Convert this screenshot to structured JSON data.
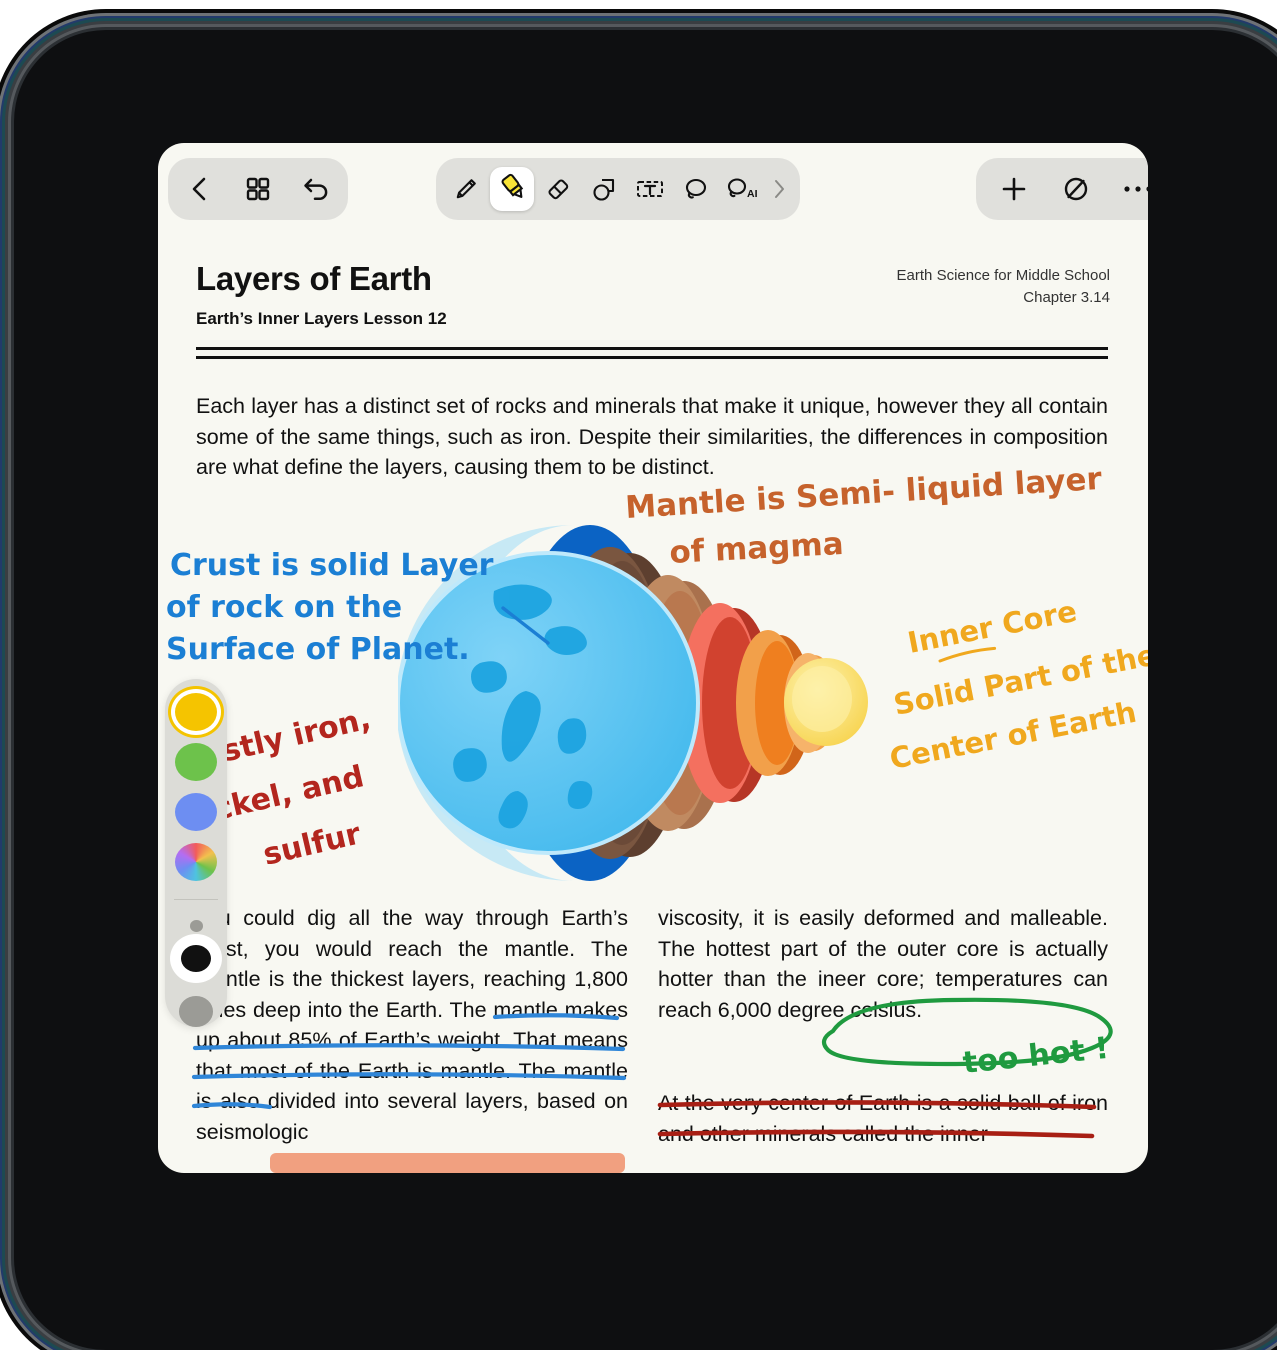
{
  "toolbar": {
    "left": [
      {
        "name": "back-button",
        "icon": "chevron-left-icon"
      },
      {
        "name": "pages-grid-button",
        "icon": "grid-icon"
      },
      {
        "name": "undo-button",
        "icon": "undo-arrow-icon"
      }
    ],
    "tools": [
      {
        "name": "pen-tool",
        "icon": "pen-icon",
        "selected": false
      },
      {
        "name": "highlighter-tool",
        "icon": "highlighter-icon",
        "selected": true
      },
      {
        "name": "eraser-tool",
        "icon": "eraser-icon",
        "selected": false
      },
      {
        "name": "shape-tool",
        "icon": "shapes-icon",
        "selected": false
      },
      {
        "name": "text-tool",
        "icon": "text-box-icon",
        "selected": false
      },
      {
        "name": "lasso-tool",
        "icon": "lasso-icon",
        "selected": false
      },
      {
        "name": "ai-lasso-tool",
        "icon": "lasso-ai-icon",
        "selected": false
      },
      {
        "name": "more-tools-chevron",
        "icon": "chevron-right-icon",
        "selected": false
      }
    ],
    "right": [
      {
        "name": "add-button",
        "icon": "plus-icon"
      },
      {
        "name": "no-fill-button",
        "icon": "slashed-circle-icon"
      },
      {
        "name": "more-options-button",
        "icon": "ellipsis-icon"
      }
    ]
  },
  "document": {
    "title": "Layers of Earth",
    "subtitle": "Earth’s Inner Layers Lesson 12",
    "meta_line1": "Earth Science for Middle School",
    "meta_line2": "Chapter 3.14",
    "intro": "Each layer has a distinct set of rocks and minerals that make it unique, however they all contain some of the same things, such as iron. Despite their similarities, the differences in composition are what define the layers, causing them to be distinct.",
    "column_left": "you could dig all the way through Earth’s crust, you would reach the mantle. The mantle is the thickest layers, reaching 1,800 miles deep into the Earth. The mantle makes up about 85% of Earth’s weight. That means that most of the Earth is mantle. The mantle is also divided into several layers, based on seismologic",
    "column_right": "viscosity, it is easily deformed and malleable. The hottest part of the outer core is actually hotter than the ineer core; temperatures can reach 6,000 degree celsius.",
    "column_right_2": "At the very center of Earth is a solid ball of iron and other minerals called the inner"
  },
  "annotations": [
    {
      "name": "annotation-crust",
      "text": "Crust is solid Layer\nof rock on the\nSurface of Planet.",
      "color": "#1b7fd4"
    },
    {
      "name": "annotation-mantle",
      "text": "Mantle is Semi- liquid layer\nof magma",
      "color": "#c6622c"
    },
    {
      "name": "annotation-inner-core",
      "text": "Inner Core\nSolid Part of the\nCenter of Earth",
      "color": "#f0a81e"
    },
    {
      "name": "annotation-composition",
      "text": "Mostly iron,\nnickel, and\nsulfur",
      "color": "#b3261e"
    },
    {
      "name": "annotation-too-hot",
      "text": "too hot !",
      "color": "#1f9a3f"
    }
  ],
  "ink_marks": {
    "blue_underline_color": "#2f86d8",
    "red_underline_color": "#a81f14",
    "green_circle_color": "#1f9a3f",
    "salmon_highlight_color": "#f0916c"
  },
  "palette": {
    "colors": [
      {
        "name": "swatch-yellow",
        "hex": "#f5c400",
        "selected": true
      },
      {
        "name": "swatch-green",
        "hex": "#6dc24b",
        "selected": false
      },
      {
        "name": "swatch-blue",
        "hex": "#6d8ef2",
        "selected": false
      },
      {
        "name": "swatch-rainbow",
        "hex": "rainbow",
        "selected": false
      }
    ],
    "widths": [
      {
        "name": "stroke-width-small",
        "selected": false
      },
      {
        "name": "stroke-width-medium",
        "selected": true
      },
      {
        "name": "stroke-width-large",
        "selected": false
      }
    ]
  },
  "earth": {
    "layers": [
      {
        "name": "crust-sphere",
        "hex": "#45bdf0"
      },
      {
        "name": "crust-rim",
        "hex": "#0b63c4"
      },
      {
        "name": "upper-mantle-ring",
        "hex": "#6b4a38"
      },
      {
        "name": "mantle-ring",
        "hex": "#b9784f"
      },
      {
        "name": "lower-mantle-ring",
        "hex": "#d1422f"
      },
      {
        "name": "outer-core-rim",
        "hex": "#f4705f"
      },
      {
        "name": "outer-core-ring",
        "hex": "#ef7f1f"
      },
      {
        "name": "inner-core-rim",
        "hex": "#f2a04a"
      },
      {
        "name": "inner-core",
        "hex": "#fbe07a"
      }
    ]
  }
}
